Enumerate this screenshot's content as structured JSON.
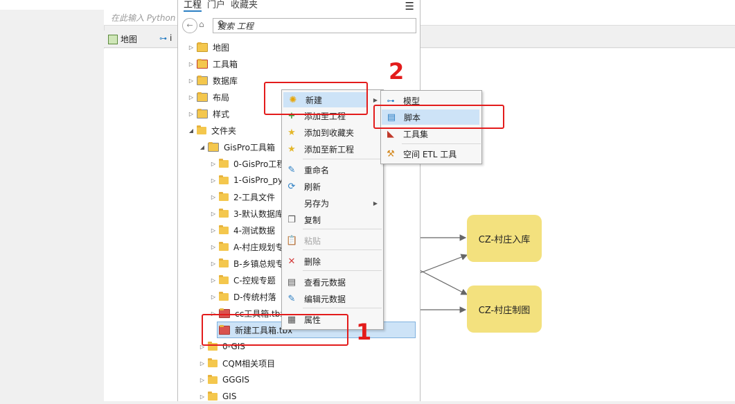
{
  "python": {
    "placeholder": "在此输入 Python 命"
  },
  "map_tabs": [
    {
      "label": "地图"
    },
    {
      "label": "i"
    }
  ],
  "pane": {
    "tabs": [
      "工程",
      "门户",
      "收藏夹"
    ],
    "search_placeholder": "搜索 工程"
  },
  "tree": [
    {
      "label": "地图",
      "icon": "map-folder-icon",
      "expanded": false
    },
    {
      "label": "工具箱",
      "icon": "toolbox-folder-icon",
      "expanded": false
    },
    {
      "label": "数据库",
      "icon": "database-folder-icon",
      "expanded": false
    },
    {
      "label": "布局",
      "icon": "layout-folder-icon",
      "expanded": false
    },
    {
      "label": "样式",
      "icon": "style-folder-icon",
      "expanded": false
    },
    {
      "label": "文件夹",
      "icon": "folder-icon",
      "expanded": true
    },
    {
      "label": "GisPro工具箱",
      "icon": "home-folder-icon",
      "expanded": true
    },
    {
      "label": "0-GisPro工程",
      "icon": "folder-icon"
    },
    {
      "label": "1-GisPro_py",
      "icon": "folder-icon"
    },
    {
      "label": "2-工具文件",
      "icon": "folder-icon"
    },
    {
      "label": "3-默认数据库",
      "icon": "folder-icon"
    },
    {
      "label": "4-测试数据",
      "icon": "folder-icon"
    },
    {
      "label": "A-村庄规划专",
      "icon": "folder-icon"
    },
    {
      "label": "B-乡镇总规专",
      "icon": "folder-icon"
    },
    {
      "label": "C-控规专题",
      "icon": "folder-icon"
    },
    {
      "label": "D-传统村落",
      "icon": "folder-icon"
    },
    {
      "label": "cc工具箱.tbx",
      "icon": "toolbox-icon"
    },
    {
      "label": "新建工具箱.tbx",
      "icon": "toolbox-icon",
      "selected": true
    },
    {
      "label": "0-GIS",
      "icon": "folder-icon"
    },
    {
      "label": "CQM相关项目",
      "icon": "folder-icon"
    },
    {
      "label": "GGGIS",
      "icon": "folder-icon"
    },
    {
      "label": "GIS",
      "icon": "folder-icon"
    }
  ],
  "context_menu": [
    {
      "label": "新建",
      "icon": "new-icon",
      "submenu": true,
      "highlighted": true
    },
    {
      "label": "添加至工程",
      "icon": "add-icon"
    },
    {
      "label": "添加到收藏夹",
      "icon": "star-icon"
    },
    {
      "label": "添加至新工程",
      "icon": "star-icon"
    },
    {
      "label": "重命名",
      "icon": "rename-icon"
    },
    {
      "label": "刷新",
      "icon": "refresh-icon"
    },
    {
      "label": "另存为",
      "icon": "",
      "submenu": true
    },
    {
      "label": "复制",
      "icon": "copy-icon"
    },
    {
      "label": "粘贴",
      "icon": "paste-icon",
      "disabled": true
    },
    {
      "label": "删除",
      "icon": "delete-icon"
    },
    {
      "label": "查看元数据",
      "icon": "metadata-icon"
    },
    {
      "label": "编辑元数据",
      "icon": "edit-metadata-icon"
    },
    {
      "label": "属性",
      "icon": "properties-icon"
    }
  ],
  "submenu": [
    {
      "label": "模型",
      "icon": "model-icon"
    },
    {
      "label": "脚本",
      "icon": "script-icon",
      "highlighted": true
    },
    {
      "label": "工具集",
      "icon": "toolset-icon"
    },
    {
      "label": "空间 ETL 工具",
      "icon": "etl-tool-icon"
    }
  ],
  "model_nodes": [
    "CZ-村庄入库",
    "CZ-村庄制图"
  ],
  "annotations": {
    "step1": "1",
    "step2": "2"
  },
  "colors": {
    "node_fill": "#f3e17e",
    "highlight": "#cde3f7",
    "annotation_red": "#e31b1b",
    "folder": "#f4c74d"
  }
}
